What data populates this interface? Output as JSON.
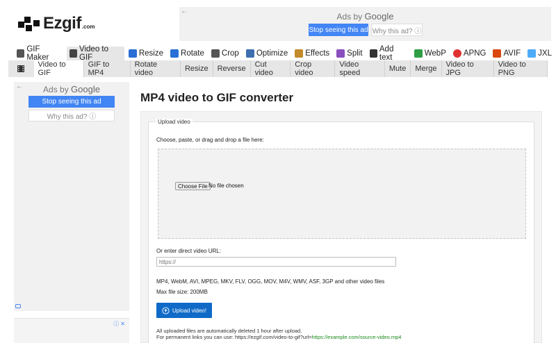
{
  "header": {
    "logo_name": "Ezgif",
    "logo_suffix": ".com"
  },
  "top_ad": {
    "ads_by": "Ads by",
    "ads_brand": "Google",
    "stop_label": "Stop seeing this ad",
    "why_label": "Why this ad? ⓘ"
  },
  "nav_primary": [
    {
      "label": "GIF Maker",
      "icon": "gif-maker-icon",
      "color": "#555555"
    },
    {
      "label": "Video to GIF",
      "icon": "video-icon",
      "color": "#444444",
      "active": true
    },
    {
      "label": "Resize",
      "icon": "resize-icon",
      "color": "#2a6fd6"
    },
    {
      "label": "Rotate",
      "icon": "rotate-icon",
      "color": "#2a6fd6"
    },
    {
      "label": "Crop",
      "icon": "crop-icon",
      "color": "#555555"
    },
    {
      "label": "Optimize",
      "icon": "optimize-icon",
      "color": "#3d6fb0"
    },
    {
      "label": "Effects",
      "icon": "effects-icon",
      "color": "#c28a2a"
    },
    {
      "label": "Split",
      "icon": "split-icon",
      "color": "#8a4fbf"
    },
    {
      "label": "Add text",
      "icon": "add-text-icon",
      "color": "#333333"
    },
    {
      "label": "WebP",
      "icon": "webp-icon",
      "color": "#2f9e44"
    },
    {
      "label": "APNG",
      "icon": "apng-icon",
      "color": "#e03131"
    },
    {
      "label": "AVIF",
      "icon": "avif-icon",
      "color": "#d9480f"
    },
    {
      "label": "JXL",
      "icon": "jxl-icon",
      "color": "#4dabf7"
    }
  ],
  "nav_secondary": [
    {
      "label": "Video to GIF",
      "active": true
    },
    {
      "label": "GIF to MP4"
    },
    {
      "label": "Rotate video"
    },
    {
      "label": "Resize"
    },
    {
      "label": "Reverse"
    },
    {
      "label": "Cut video"
    },
    {
      "label": "Crop video"
    },
    {
      "label": "Video speed"
    },
    {
      "label": "Mute"
    },
    {
      "label": "Merge"
    },
    {
      "label": "Video to JPG"
    },
    {
      "label": "Video to PNG"
    }
  ],
  "side_ad": {
    "ads_by": "Ads by",
    "ads_brand": "Google",
    "stop_label": "Stop seeing this ad",
    "why_label": "Why this ad? ⓘ"
  },
  "main": {
    "title": "MP4 video to GIF converter",
    "legend": "Upload video",
    "choose_label": "Choose, paste, or drag and drop a file here:",
    "file_button": "Choose File",
    "file_status": "No file chosen",
    "url_label": "Or enter direct video URL:",
    "url_placeholder": "https://",
    "formats": "MP4, WebM, AVI, MPEG, MKV, FLV, OGG, MOV, M4V, WMV, ASF, 3GP and other video files",
    "max_size": "Max file size: 200MB",
    "upload_button": "Upload video!",
    "note1": "All uploaded files are automatically deleted 1 hour after upload.",
    "note2_prefix": "For permanent links you can use: https://ezgif.com/video-to-gif?url=",
    "note2_link": "https://example.com/source-video.mp4"
  },
  "colors": {
    "accent_blue": "#4285f4",
    "upload_blue": "#0f6ac7",
    "link_green": "#1b8a1b"
  }
}
